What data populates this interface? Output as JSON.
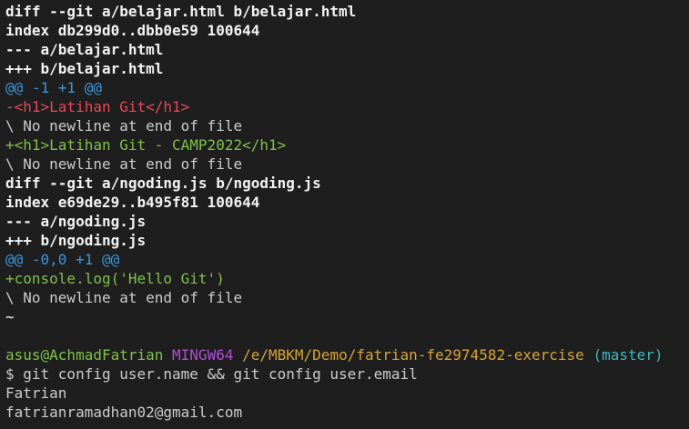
{
  "diff1": {
    "header": "diff --git a/belajar.html b/belajar.html",
    "index": "index db299d0..dbb0e59 100644",
    "old_file": "--- a/belajar.html",
    "new_file": "+++ b/belajar.html",
    "hunk": "@@ -1 +1 @@",
    "removed": "-<h1>Latihan Git</h1>",
    "no_newline_1": "\\ No newline at end of file",
    "added": "+<h1>Latihan Git - CAMP2022</h1>",
    "no_newline_2": "\\ No newline at end of file"
  },
  "diff2": {
    "header": "diff --git a/ngoding.js b/ngoding.js",
    "index": "index e69de29..b495f81 100644",
    "old_file": "--- a/ngoding.js",
    "new_file": "+++ b/ngoding.js",
    "hunk": "@@ -0,0 +1 @@",
    "added": "+console.log('Hello Git')",
    "no_newline": "\\ No newline at end of file"
  },
  "end_marker": "~",
  "prompt": {
    "user_host": "asus@AchmadFatrian",
    "system": "MINGW64",
    "path": "/e/MBKM/Demo/fatrian-fe2974582-exercise",
    "branch": "(master)"
  },
  "command": "$ git config user.name && git config user.email",
  "output": {
    "user_name": "Fatrian",
    "user_email": "fatrianramadhan02@gmail.com"
  },
  "colors": {
    "background": "#1e1e1e",
    "text": "#cccccc",
    "hunk": "#3a96dd",
    "removed": "#e74856",
    "added": "#7fc04a",
    "prompt_user": "#7fc04a",
    "prompt_system": "#b14fd6",
    "prompt_path": "#d6a33a",
    "prompt_branch": "#3ab7c2"
  }
}
